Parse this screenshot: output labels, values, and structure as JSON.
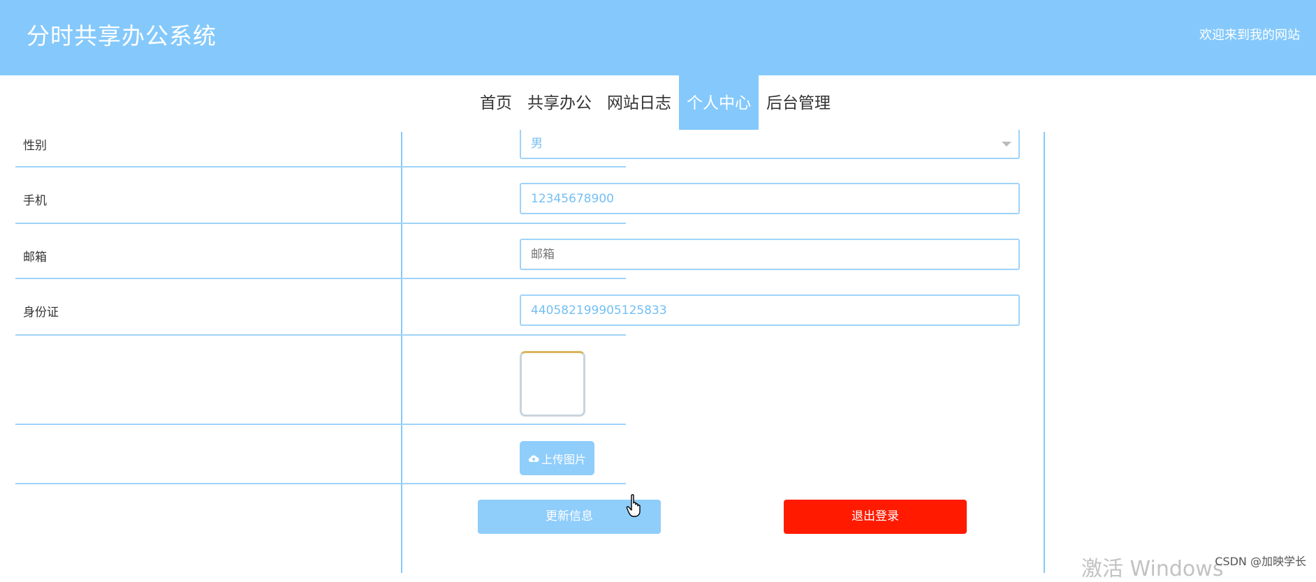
{
  "header": {
    "title": "分时共享办公系统",
    "welcome": "欢迎来到我的网站",
    "background": "#85c9fc"
  },
  "nav": {
    "items": [
      {
        "label": "首页",
        "active": false
      },
      {
        "label": "共享办公",
        "active": false
      },
      {
        "label": "网站日志",
        "active": false
      },
      {
        "label": "个人中心",
        "active": true
      },
      {
        "label": "后台管理",
        "active": false
      }
    ]
  },
  "form": {
    "gender": {
      "label": "性别",
      "value": "男"
    },
    "phone": {
      "label": "手机",
      "value": "12345678900"
    },
    "email": {
      "label": "邮箱",
      "value": "",
      "placeholder": "邮箱"
    },
    "id_card": {
      "label": "身份证",
      "value": "440582199905125833"
    },
    "upload_label": "上传图片"
  },
  "actions": {
    "update_label": "更新信息",
    "logout_label": "退出登录",
    "update_color": "#8fcdfb",
    "logout_color": "#ff1a00"
  },
  "overlay": {
    "watermark": "激活 Windows",
    "credit": "CSDN @加映学长"
  }
}
